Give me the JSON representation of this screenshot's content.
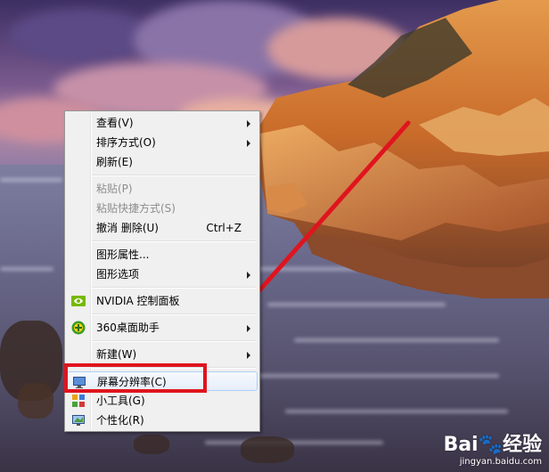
{
  "context_menu": {
    "items": [
      {
        "label": "查看(V)",
        "submenu": true
      },
      {
        "label": "排序方式(O)",
        "submenu": true
      },
      {
        "label": "刷新(E)"
      },
      {
        "label": "粘贴(P)",
        "disabled": true
      },
      {
        "label": "粘贴快捷方式(S)",
        "disabled": true
      },
      {
        "label": "撤消 删除(U)",
        "shortcut": "Ctrl+Z"
      },
      {
        "label": "图形属性..."
      },
      {
        "label": "图形选项",
        "submenu": true
      },
      {
        "label": "NVIDIA 控制面板",
        "icon": "nvidia-icon"
      },
      {
        "label": "360桌面助手",
        "icon": "360-assistant-icon",
        "submenu": true
      },
      {
        "label": "新建(W)",
        "submenu": true
      },
      {
        "label": "屏幕分辨率(C)",
        "icon": "display-resolution-icon",
        "highlighted": true
      },
      {
        "label": "小工具(G)",
        "icon": "gadgets-icon"
      },
      {
        "label": "个性化(R)",
        "icon": "personalize-icon"
      }
    ]
  },
  "annotation": {
    "color": "#e0141e"
  },
  "watermark": {
    "brand": "Bai🐾经验",
    "url": "jingyan.baidu.com"
  }
}
